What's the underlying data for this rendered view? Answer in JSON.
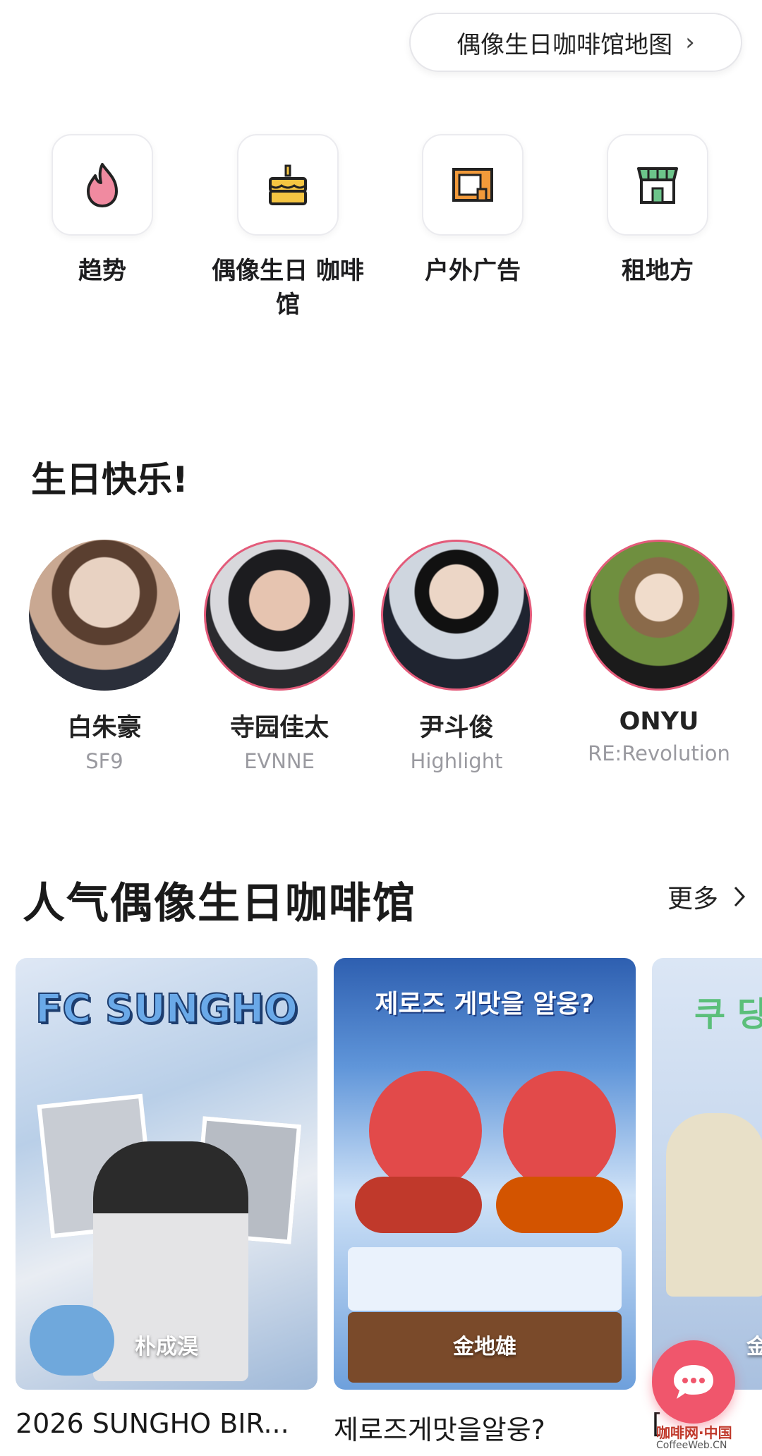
{
  "map_button": {
    "label": "偶像生日咖啡馆地图",
    "chevron": "›"
  },
  "quick_menu": [
    {
      "label": "趋势",
      "icon": "flame-icon"
    },
    {
      "label": "偶像生日 咖啡馆",
      "icon": "birthday-cake-icon"
    },
    {
      "label": "户外广告",
      "icon": "billboard-icon"
    },
    {
      "label": "租地方",
      "icon": "storefront-icon"
    }
  ],
  "birthday": {
    "title": "生日快乐!",
    "idols": [
      {
        "name": "白朱豪",
        "group": "SF9"
      },
      {
        "name": "寺园佳太",
        "group": "EVNNE"
      },
      {
        "name": "尹斗俊",
        "group": "Highlight"
      },
      {
        "name": "ONYU",
        "group": "RE:Revolution"
      }
    ]
  },
  "popular": {
    "title": "人气偶像生日咖啡馆",
    "more_label": "更多",
    "cards": [
      {
        "idol": "朴成淏",
        "title": "2026 SUNGHO BIR...",
        "banner": "FC SUNGHO"
      },
      {
        "idol": "金地雄",
        "title": "제로즈게맛을알웅?",
        "banner": "제로즈 게맛을 알웅?"
      },
      {
        "idol": "金",
        "title": "[",
        "banner": "쿠 당"
      }
    ]
  },
  "colors": {
    "accent": "#f0566c",
    "ring": "#e35b7a",
    "muted": "#9a9aa0"
  },
  "watermark": {
    "cn": "咖啡网·中国",
    "en": "CoffeeWeb.CN"
  }
}
